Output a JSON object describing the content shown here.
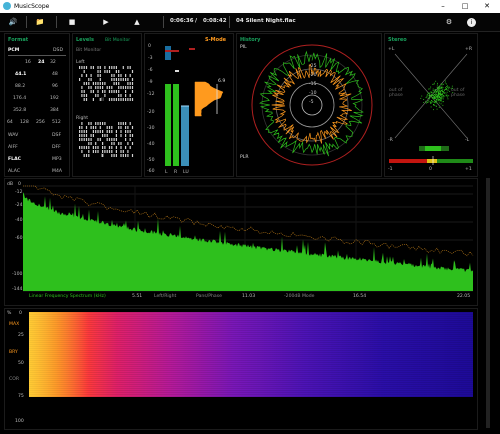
{
  "window": {
    "title": "MusicScope"
  },
  "toolbar": {
    "time_elapsed": "0:06:36",
    "time_divider": "/",
    "time_total": "0:08:42",
    "track": "04 Silent Night.flac",
    "icons": [
      "volume-icon",
      "folder-icon",
      "stop-icon",
      "play-icon",
      "metronome-icon",
      "gear-icon",
      "info-icon"
    ]
  },
  "format": {
    "title": "Format",
    "pcm": "PCM",
    "dsd": "DSD",
    "bitdepths": [
      "16",
      "24",
      "32"
    ],
    "rates_left": [
      "44.1",
      "88.2",
      "176.4",
      "352.8"
    ],
    "rates_right": [
      "48",
      "96",
      "192",
      "384"
    ],
    "bottom_rates": [
      "64",
      "128",
      "256",
      "512"
    ],
    "formats_left": [
      "WAV",
      "AIFF",
      "FLAC",
      "ALAC"
    ],
    "formats_right": [
      "DSF",
      "DFF",
      "MP3",
      "M4A"
    ]
  },
  "levels": {
    "title": "Levels",
    "subtitle": "Bit Monitor",
    "monitor_label": "Bit Monitor",
    "left": "Left",
    "right": "Right",
    "mark": "II"
  },
  "smode": {
    "title": "S-Mode",
    "peak_value": "6.9",
    "scale": [
      "0",
      "-3",
      "-6",
      "-9",
      "-12",
      "-20",
      "-30",
      "-40",
      "-50",
      "-60"
    ],
    "channels": [
      "L",
      "R",
      "LU"
    ]
  },
  "history": {
    "title": "History",
    "pl": "PIL",
    "plr": "PLR"
  },
  "stereo": {
    "title": "Stereo",
    "plus_l": "+L",
    "plus_r": "+R",
    "minus_l": "-R",
    "minus_r": "-L",
    "out_of_phase": "out of phase",
    "scale": [
      "-1",
      "0",
      "+1"
    ]
  },
  "spectrum": {
    "db_label": "dB",
    "y_ticks": [
      "0",
      "-12",
      "-24",
      "-40",
      "-60",
      "-100",
      "-144"
    ],
    "caption": "Linear Frequency Spectrum (kHz)",
    "x_ticks": [
      "5.51",
      "11.03",
      "16.54",
      "22.05"
    ],
    "modes": [
      "Left/Right",
      "Pans/Phase",
      "-200dB Mode"
    ]
  },
  "spectrogram": {
    "pct": "%",
    "ticks": [
      "0",
      "25",
      "50",
      "75",
      "100"
    ],
    "labels": [
      "MAX",
      "BRY",
      "COR"
    ]
  },
  "colors": {
    "green": "#2ec01d",
    "orange": "#ff9a1e",
    "red": "#c3150f",
    "cyan": "#3bb4c8",
    "accent_title": "#19a15c"
  }
}
